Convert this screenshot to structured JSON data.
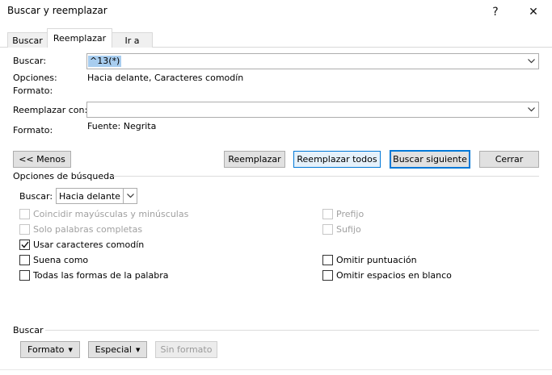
{
  "window": {
    "title": "Buscar y reemplazar",
    "help_glyph": "?",
    "close_glyph": "✕"
  },
  "tabs": [
    {
      "label": "Buscar",
      "active": false
    },
    {
      "label": "Reemplazar",
      "active": true
    },
    {
      "label": "Ir a",
      "active": false
    }
  ],
  "find": {
    "label": "Buscar:",
    "value": "^13(*)",
    "options_label": "Opciones:",
    "options_value": "Hacia delante, Caracteres comodín",
    "format_label": "Formato:",
    "format_value": ""
  },
  "replace": {
    "label": "Reemplazar con:",
    "value": "",
    "format_label": "Formato:",
    "format_value": "Fuente: Negrita"
  },
  "buttons": {
    "less": "<< Menos",
    "replace": "Reemplazar",
    "replace_all": "Reemplazar todos",
    "find_next": "Buscar siguiente",
    "close": "Cerrar"
  },
  "search_options": {
    "heading": "Opciones de búsqueda",
    "direction_label": "Buscar:",
    "direction_value": "Hacia delante",
    "left": [
      {
        "label": "Coincidir mayúsculas y minúsculas",
        "checked": false,
        "enabled": false
      },
      {
        "label": "Solo palabras completas",
        "checked": false,
        "enabled": false
      },
      {
        "label": "Usar caracteres comodín",
        "checked": true,
        "enabled": true
      },
      {
        "label": "Suena como",
        "checked": false,
        "enabled": true
      },
      {
        "label": "Todas las formas de la palabra",
        "checked": false,
        "enabled": true
      }
    ],
    "right": [
      {
        "label": "Prefijo",
        "checked": false,
        "enabled": false
      },
      {
        "label": "Sufijo",
        "checked": false,
        "enabled": false
      },
      {
        "label": "Omitir puntuación",
        "checked": false,
        "enabled": true
      },
      {
        "label": "Omitir espacios en blanco",
        "checked": false,
        "enabled": true
      }
    ]
  },
  "bottom": {
    "heading": "Buscar",
    "format_button": "Formato",
    "special_button": "Especial",
    "no_format_button": "Sin formato"
  },
  "colors": {
    "accent": "#0078d7",
    "selection": "#a8cdef"
  }
}
